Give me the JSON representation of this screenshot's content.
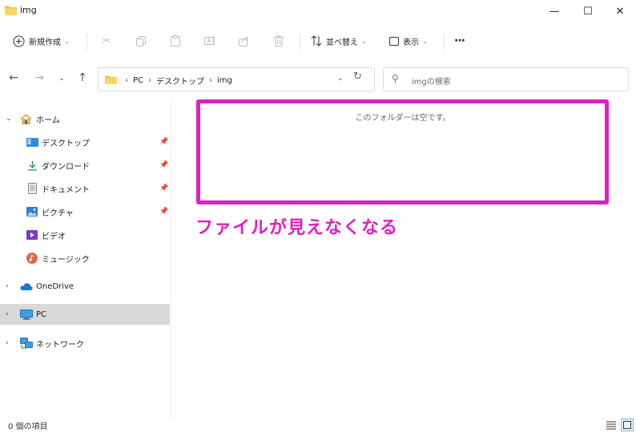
{
  "window": {
    "title": "img",
    "minimize": "—",
    "maximize": "☐",
    "close": "✕"
  },
  "toolbar": {
    "new_label": "新規作成",
    "sort_label": "並べ替え",
    "view_label": "表示",
    "more_label": "···"
  },
  "address": {
    "crumbs": [
      "PC",
      "デスクトップ",
      "img"
    ]
  },
  "search": {
    "placeholder": "imgの検索"
  },
  "sidebar": {
    "home": "ホーム",
    "quick": [
      {
        "label": "デスクトップ"
      },
      {
        "label": "ダウンロード"
      },
      {
        "label": "ドキュメント"
      },
      {
        "label": "ピクチャ"
      },
      {
        "label": "ビデオ"
      },
      {
        "label": "ミュージック"
      }
    ],
    "onedrive": "OneDrive",
    "pc": "PC",
    "network": "ネットワーク"
  },
  "main": {
    "empty_message": "このフォルダーは空です。",
    "annotation": "ファイルが見えなくなる"
  },
  "status": {
    "item_count": "0 個の項目"
  },
  "colors": {
    "annotation": "#e020c0",
    "folder": "#f4c542",
    "selected_bg": "#d9d9d9"
  }
}
